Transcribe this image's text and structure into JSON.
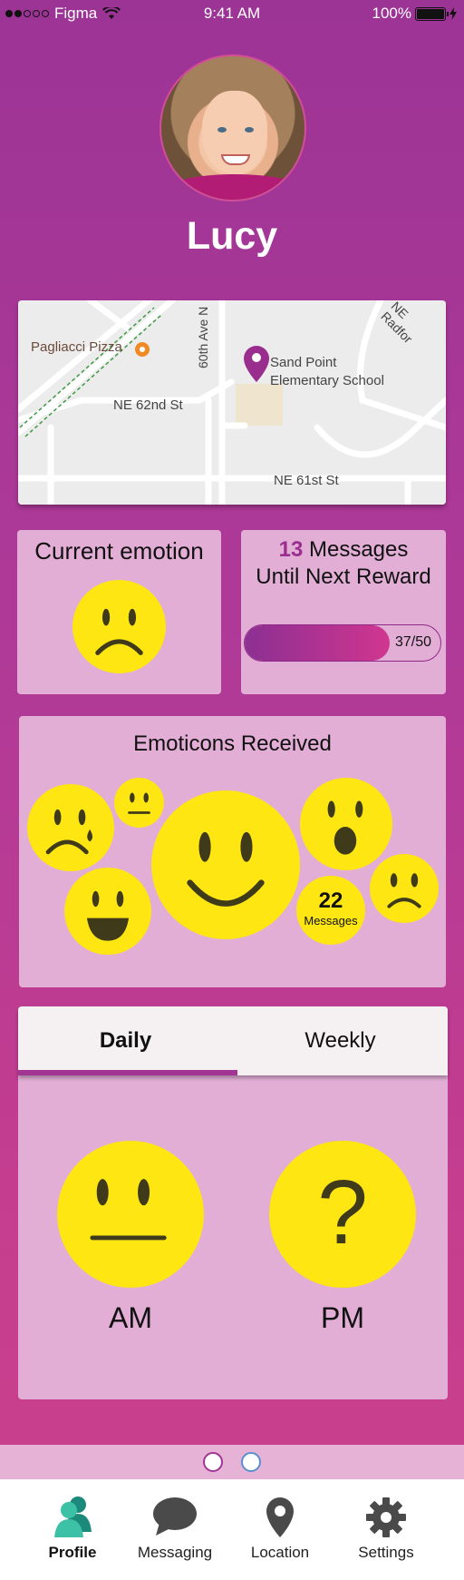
{
  "status_bar": {
    "carrier": "Figma",
    "time": "9:41 AM",
    "battery": "100%"
  },
  "profile": {
    "name": "Lucy"
  },
  "map": {
    "labels": {
      "pizza": "Pagliacci Pizza",
      "school_line1": "Sand Point",
      "school_line2": "Elementary School",
      "street_62nd": "NE 62nd St",
      "street_61st": "NE 61st St",
      "avenue_60th": "60th Ave N",
      "radford": "NE Radfor"
    }
  },
  "current_emotion": {
    "title": "Current emotion",
    "emotion": "sad"
  },
  "messages": {
    "count": "13",
    "line1_suffix": "Messages",
    "line2": "Until Next Reward",
    "progress_label": "37/50",
    "progress_fraction": 0.74
  },
  "emoticons_received": {
    "title": "Emoticons Received",
    "items": [
      "crying",
      "neutral",
      "smile",
      "surprised",
      "happy",
      "frown"
    ],
    "messages_count": "22",
    "messages_label": "Messages"
  },
  "daily_weekly": {
    "tabs": [
      "Daily",
      "Weekly"
    ],
    "active_tab": "Daily",
    "am_label": "AM",
    "pm_label": "PM",
    "am_emotion": "neutral",
    "pm_symbol": "?"
  },
  "tab_bar": {
    "items": [
      {
        "label": "Profile",
        "icon": "people-icon",
        "active": true
      },
      {
        "label": "Messaging",
        "icon": "chat-bubble-icon",
        "active": false
      },
      {
        "label": "Location",
        "icon": "location-pin-icon",
        "active": false
      },
      {
        "label": "Settings",
        "icon": "gear-icon",
        "active": false
      }
    ]
  },
  "colors": {
    "accent": "#a23593",
    "emoji_yellow": "#fde612",
    "card_bg": "#e2aed6"
  }
}
